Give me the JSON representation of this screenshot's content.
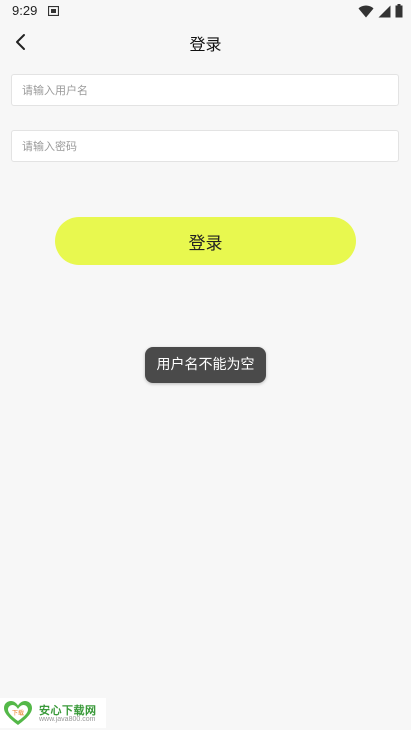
{
  "status_bar": {
    "time": "9:29",
    "icons": [
      "sim-card-icon",
      "wifi-icon",
      "cell-signal-icon",
      "battery-icon"
    ]
  },
  "header": {
    "title": "登录",
    "back_icon": "chevron-left-icon"
  },
  "form": {
    "username": {
      "placeholder": "请输入用户名",
      "value": ""
    },
    "password": {
      "placeholder": "请输入密码",
      "value": ""
    },
    "login_label": "登录"
  },
  "toast": {
    "message": "用户名不能为空"
  },
  "watermark": {
    "name": "安心下载网",
    "url": "www.java800.com",
    "logo_text": "下载"
  },
  "colors": {
    "background": "#f7f7f7",
    "accent": "#e8f84f",
    "toast": "#4a4a4a",
    "watermark_green": "#3a9a3a"
  }
}
